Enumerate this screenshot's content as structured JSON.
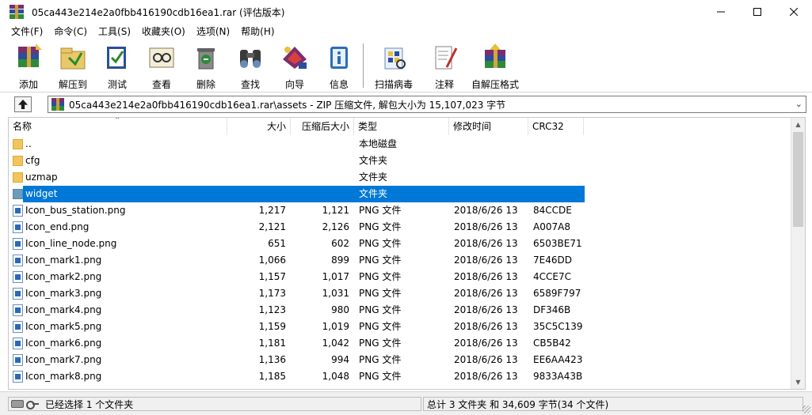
{
  "window": {
    "title": "05ca443e214e2a0fbb416190cdb16ea1.rar (评估版本)",
    "minimize_icon": "minimize-icon",
    "maximize_icon": "maximize-icon",
    "close_icon": "close-icon"
  },
  "menu": {
    "items": [
      "文件(F)",
      "命令(C)",
      "工具(S)",
      "收藏夹(O)",
      "选项(N)",
      "帮助(H)"
    ]
  },
  "toolbar": {
    "items": [
      {
        "label": "添加",
        "icon": "add-archive-icon"
      },
      {
        "label": "解压到",
        "icon": "extract-to-icon"
      },
      {
        "label": "测试",
        "icon": "test-icon"
      },
      {
        "label": "查看",
        "icon": "view-icon"
      },
      {
        "label": "删除",
        "icon": "delete-icon"
      },
      {
        "label": "查找",
        "icon": "find-icon"
      },
      {
        "label": "向导",
        "icon": "wizard-icon"
      },
      {
        "label": "信息",
        "icon": "info-icon"
      },
      {
        "label": "扫描病毒",
        "icon": "virus-scan-icon"
      },
      {
        "label": "注释",
        "icon": "comment-icon"
      },
      {
        "label": "自解压格式",
        "icon": "sfx-icon"
      }
    ]
  },
  "pathbar": {
    "path": "05ca443e214e2a0fbb416190cdb16ea1.rar\\assets - ZIP 压缩文件, 解包大小为 15,107,023 字节"
  },
  "table": {
    "columns": [
      "名称",
      "大小",
      "压缩后大小",
      "类型",
      "修改时间",
      "CRC32"
    ],
    "rows": [
      {
        "name": "..",
        "size": "",
        "packed": "",
        "type": "本地磁盘",
        "modified": "",
        "crc": "",
        "kind": "folder"
      },
      {
        "name": "cfg",
        "size": "",
        "packed": "",
        "type": "文件夹",
        "modified": "",
        "crc": "",
        "kind": "folder"
      },
      {
        "name": "uzmap",
        "size": "",
        "packed": "",
        "type": "文件夹",
        "modified": "",
        "crc": "",
        "kind": "folder"
      },
      {
        "name": "widget",
        "size": "",
        "packed": "",
        "type": "文件夹",
        "modified": "",
        "crc": "",
        "kind": "folder",
        "selected": true
      },
      {
        "name": "Icon_bus_station.png",
        "size": "1,217",
        "packed": "1,121",
        "type": "PNG 文件",
        "modified": "2018/6/26 13",
        "crc": "84CCDE",
        "kind": "png"
      },
      {
        "name": "Icon_end.png",
        "size": "2,121",
        "packed": "2,126",
        "type": "PNG 文件",
        "modified": "2018/6/26 13",
        "crc": "A007A8",
        "kind": "png"
      },
      {
        "name": "Icon_line_node.png",
        "size": "651",
        "packed": "602",
        "type": "PNG 文件",
        "modified": "2018/6/26 13",
        "crc": "6503BE71",
        "kind": "png"
      },
      {
        "name": "Icon_mark1.png",
        "size": "1,066",
        "packed": "899",
        "type": "PNG 文件",
        "modified": "2018/6/26 13",
        "crc": "7E46DD",
        "kind": "png"
      },
      {
        "name": "Icon_mark2.png",
        "size": "1,157",
        "packed": "1,017",
        "type": "PNG 文件",
        "modified": "2018/6/26 13",
        "crc": "4CCE7C",
        "kind": "png"
      },
      {
        "name": "Icon_mark3.png",
        "size": "1,173",
        "packed": "1,031",
        "type": "PNG 文件",
        "modified": "2018/6/26 13",
        "crc": "6589F797",
        "kind": "png"
      },
      {
        "name": "Icon_mark4.png",
        "size": "1,123",
        "packed": "980",
        "type": "PNG 文件",
        "modified": "2018/6/26 13",
        "crc": "DF346B",
        "kind": "png"
      },
      {
        "name": "Icon_mark5.png",
        "size": "1,159",
        "packed": "1,019",
        "type": "PNG 文件",
        "modified": "2018/6/26 13",
        "crc": "35C5C139",
        "kind": "png"
      },
      {
        "name": "Icon_mark6.png",
        "size": "1,181",
        "packed": "1,042",
        "type": "PNG 文件",
        "modified": "2018/6/26 13",
        "crc": "CB5B42",
        "kind": "png"
      },
      {
        "name": "Icon_mark7.png",
        "size": "1,136",
        "packed": "994",
        "type": "PNG 文件",
        "modified": "2018/6/26 13",
        "crc": "EE6AA423",
        "kind": "png"
      },
      {
        "name": "Icon_mark8.png",
        "size": "1,185",
        "packed": "1,048",
        "type": "PNG 文件",
        "modified": "2018/6/26 13",
        "crc": "9833A43B",
        "kind": "png"
      }
    ]
  },
  "status": {
    "left": "已经选择 1 个文件夹",
    "right": "总计 3 文件夹 和 34,609 字节(34 个文件)"
  },
  "colors": {
    "selection": "#0078d7",
    "folder": "#f2c55c"
  }
}
